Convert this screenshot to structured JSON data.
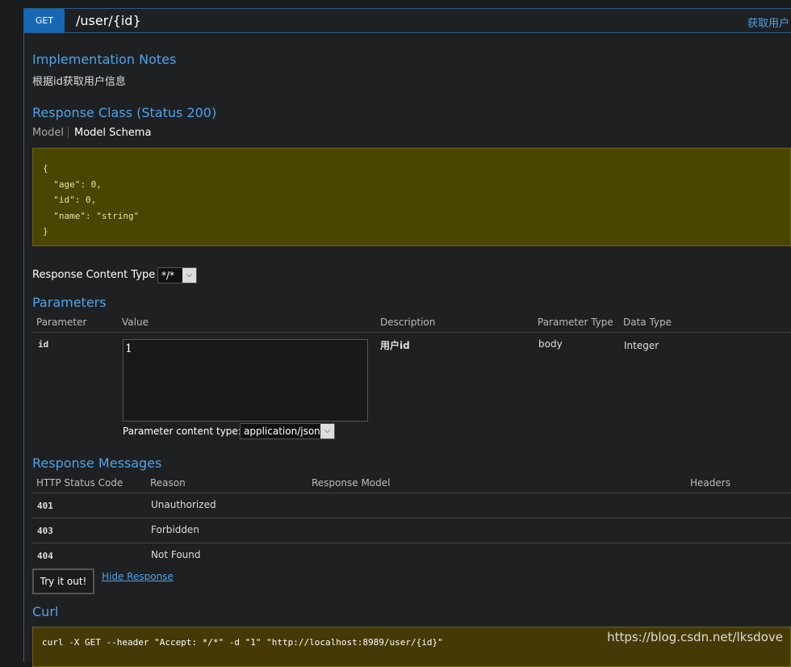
{
  "operation": {
    "method": "GET",
    "path": "/user/{id}",
    "summary": "获取用户"
  },
  "implementation_notes": {
    "title": "Implementation Notes",
    "text": "根据id获取用户信息"
  },
  "response_class": {
    "title": "Response Class (Status 200)",
    "tabs": [
      "Model",
      "Model Schema"
    ],
    "schema_lines": [
      "{",
      "  \"age\": 0,",
      "  \"id\": 0,",
      "  \"name\": \"string\"",
      "}"
    ]
  },
  "response_content_type": {
    "label": "Response Content Type",
    "value": "*/*"
  },
  "parameters": {
    "title": "Parameters",
    "headers": [
      "Parameter",
      "Value",
      "Description",
      "Parameter Type",
      "Data Type"
    ],
    "rows": [
      {
        "name": "id",
        "value": "1",
        "description": "用户id",
        "param_type": "body",
        "data_type": "Integer"
      }
    ],
    "content_type_label": "Parameter content type:",
    "content_type_value": "application/json"
  },
  "response_messages": {
    "title": "Response Messages",
    "headers": [
      "HTTP Status Code",
      "Reason",
      "Response Model",
      "Headers"
    ],
    "rows": [
      {
        "code": "401",
        "reason": "Unauthorized"
      },
      {
        "code": "403",
        "reason": "Forbidden"
      },
      {
        "code": "404",
        "reason": "Not Found"
      }
    ]
  },
  "actions": {
    "try": "Try it out!",
    "hide": "Hide Response"
  },
  "curl": {
    "title": "Curl",
    "command": "curl -X GET --header \"Accept: */*\" -d \"1\" \"http://localhost:8989/user/{id}\""
  },
  "watermark": "https://blog.csdn.net/lksdove"
}
